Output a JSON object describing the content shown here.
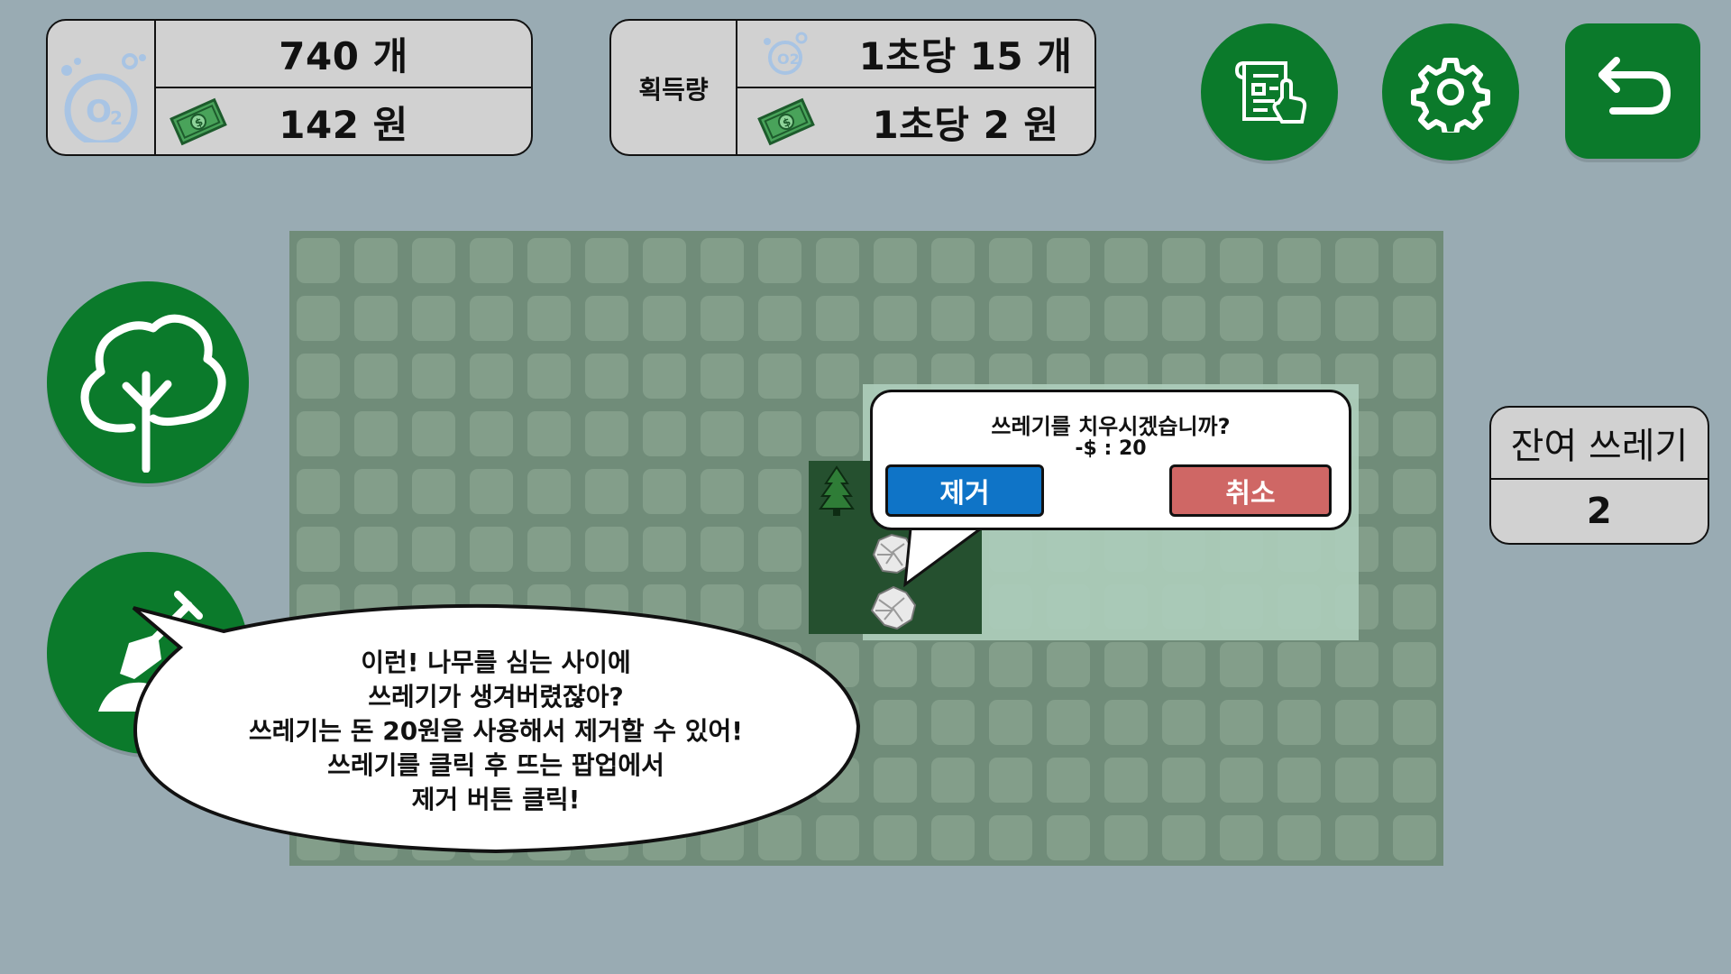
{
  "resources": {
    "oxygen_value": "740 개",
    "money_value": "142 원"
  },
  "income": {
    "label": "획득량",
    "oxygen_rate": "1초당 15 개",
    "money_rate": "1초당 2 원"
  },
  "top_buttons": {
    "quest_icon": "quest-scroll-icon",
    "settings_icon": "gear-icon",
    "back_icon": "undo-arrow-icon"
  },
  "side_buttons": {
    "plant_icon": "tree-icon",
    "remove_icon": "shovel-icon"
  },
  "popup": {
    "question": "쓰레기를 치우시겠습니까?",
    "cost": "-$ : 20",
    "confirm_label": "제거",
    "cancel_label": "취소"
  },
  "remaining": {
    "label": "잔여 쓰레기",
    "value": "2"
  },
  "tutorial": {
    "lines": [
      "이런! 나무를 심는 사이에",
      "쓰레기가 생겨버렸잖아?",
      "쓰레기는 돈 20원을 사용해서 제거할 수 있어!",
      "쓰레기를 클릭 후 뜨는 팝업에서",
      "제거 버튼 클릭!"
    ]
  },
  "colors": {
    "background": "#99abb3",
    "button_green": "#0b7a2b",
    "confirm_blue": "#0f74c7",
    "cancel_red": "#cf6765",
    "panel_gray": "#d1d1d1"
  }
}
